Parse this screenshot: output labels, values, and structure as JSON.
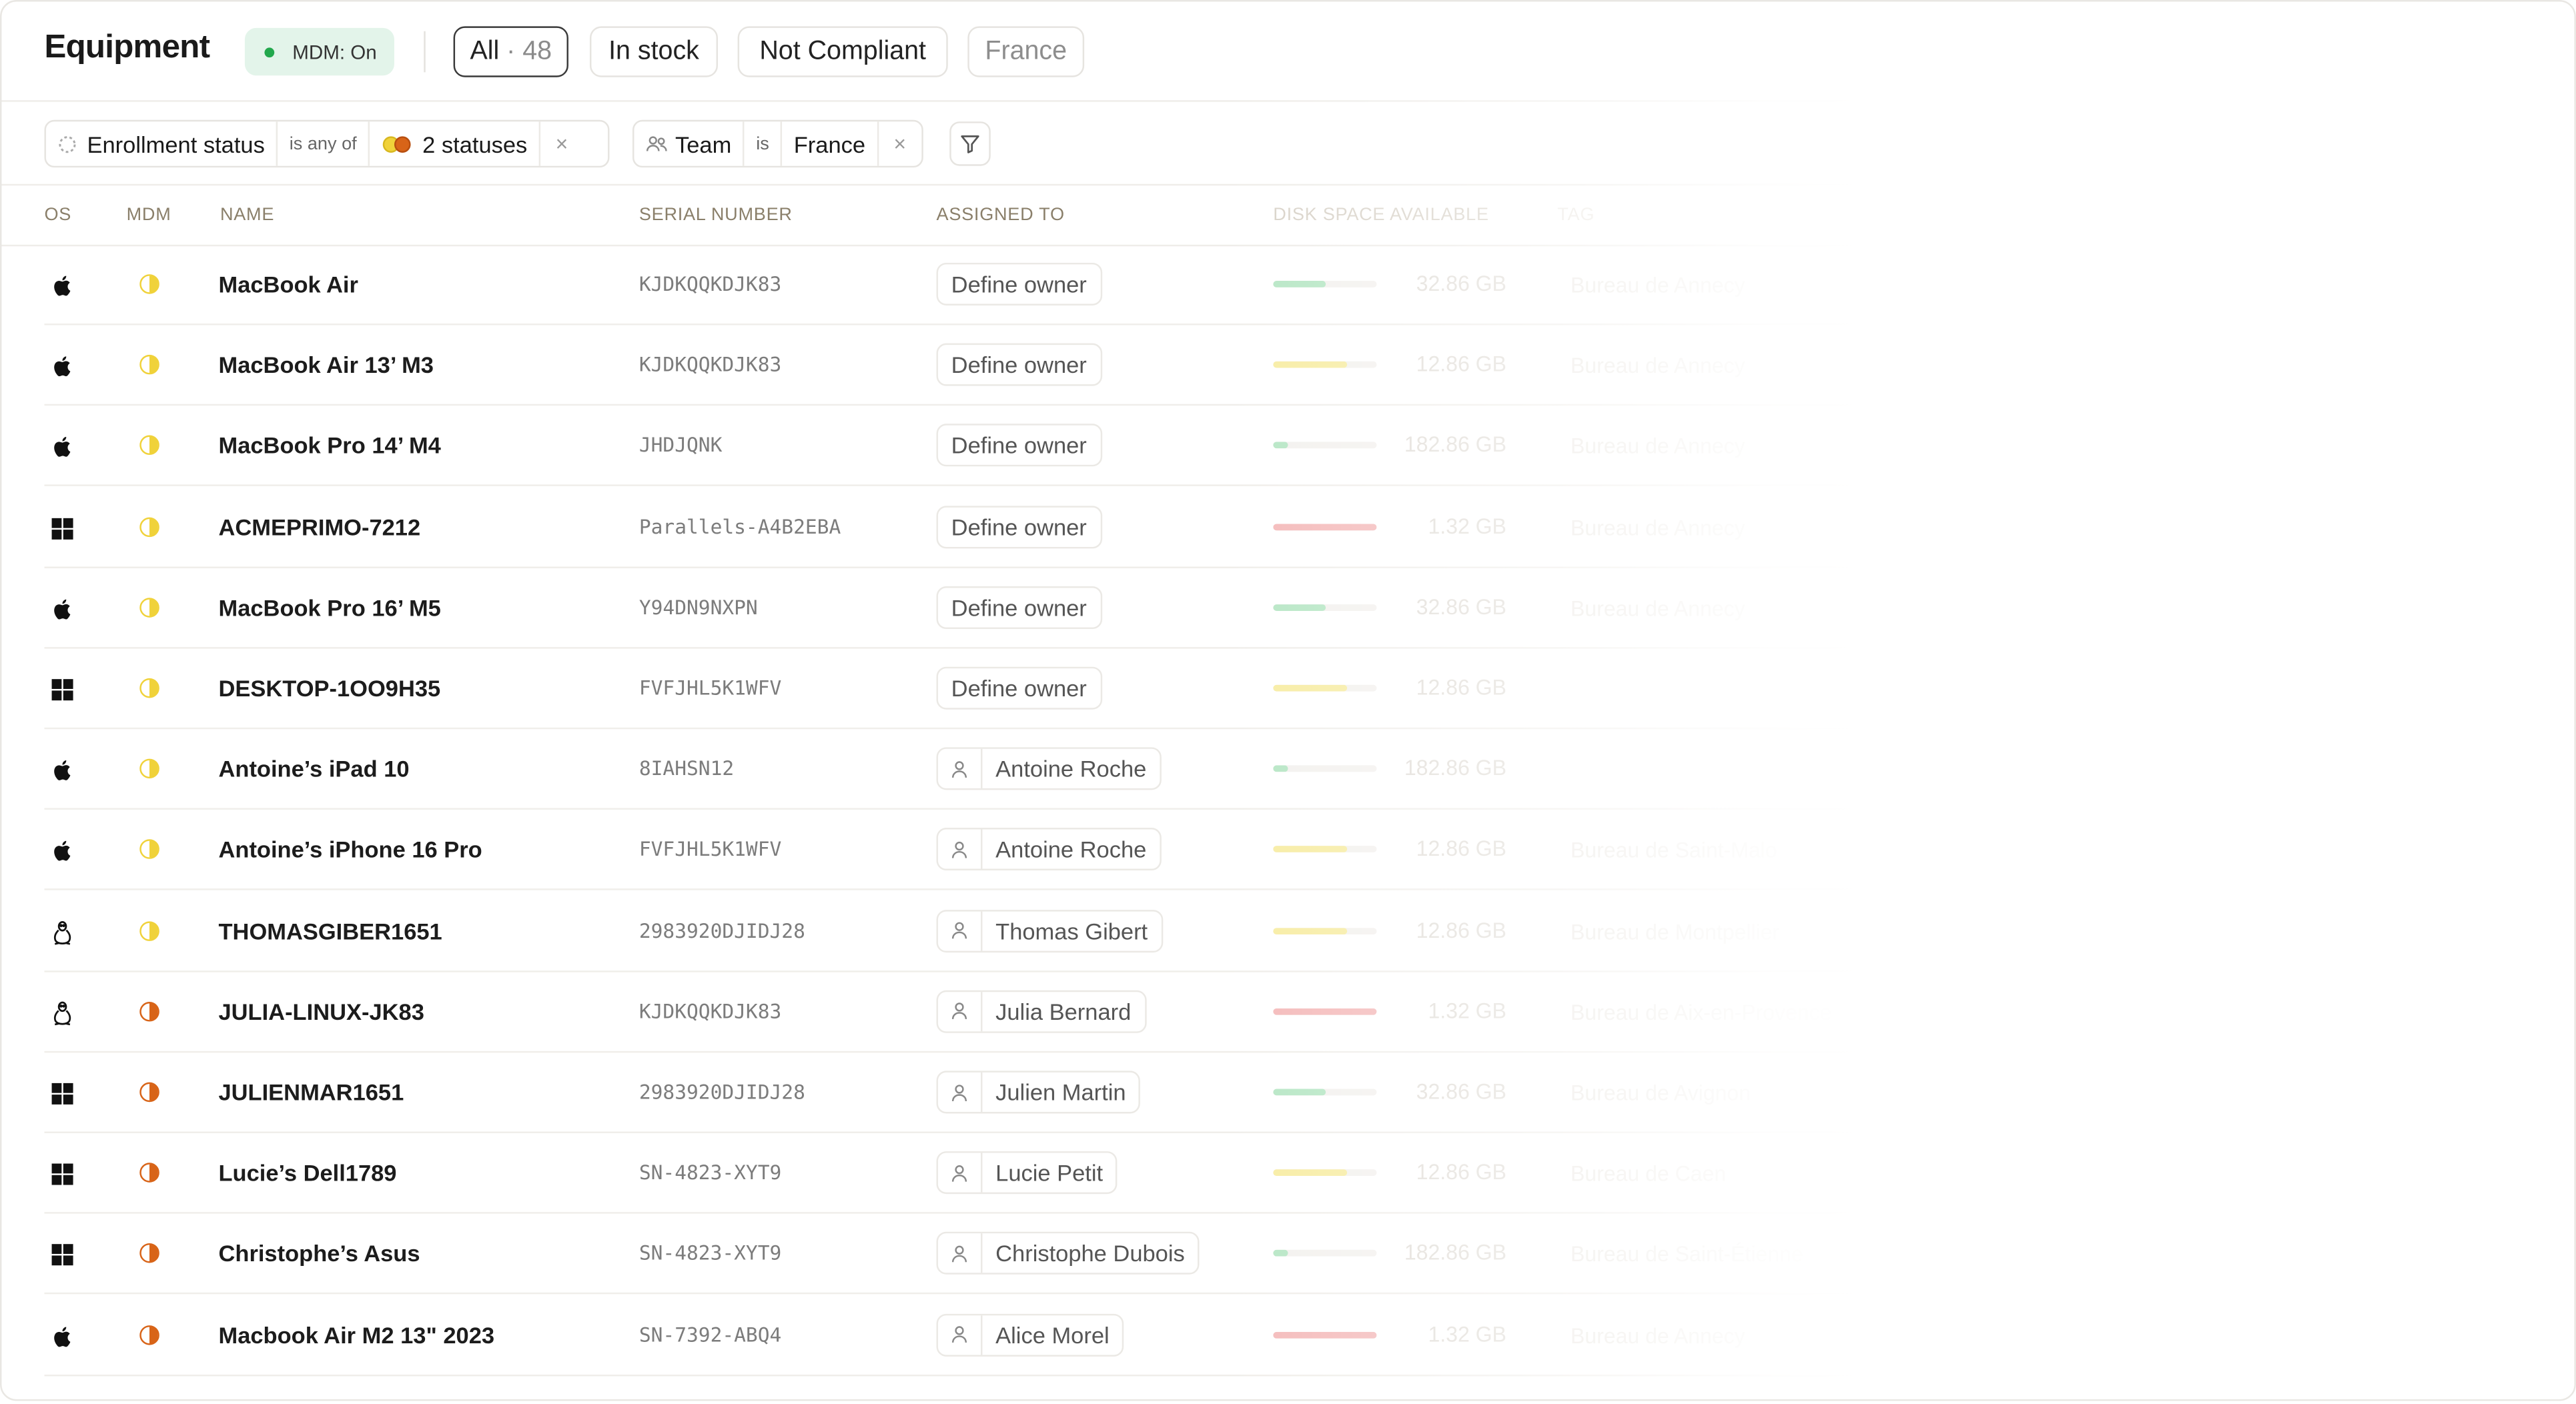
{
  "header": {
    "title": "Equipment",
    "mdm_badge": "MDM: On",
    "tabs": [
      {
        "label": "All",
        "count": "48"
      },
      {
        "label": "In stock"
      },
      {
        "label": "Not Compliant"
      },
      {
        "label": "France"
      }
    ]
  },
  "filters": {
    "enrollment": {
      "field": "Enrollment status",
      "operator": "is any of",
      "value": "2 statuses"
    },
    "team": {
      "field": "Team",
      "operator": "is",
      "value": "France"
    }
  },
  "columns": {
    "os": "OS",
    "mdm": "MDM",
    "name": "NAME",
    "serial": "SERIAL NUMBER",
    "assigned": "ASSIGNED TO",
    "disk": "DISK SPACE AVAILABLE",
    "tag": "TAG"
  },
  "colors": {
    "disk_ok": "#b6e6c4",
    "disk_warn": "#f7eca2",
    "disk_low": "#f4b9b9",
    "mdm_partial": "#f0d23a",
    "mdm_fail": "#d86418",
    "badge_bg": "#e3f4ea",
    "badge_dot": "#22a84d"
  },
  "rows": [
    {
      "os": "apple",
      "mdm": "partial",
      "name": "MacBook Air",
      "serial": "KJDKQQKDJK83",
      "owner": "Define owner",
      "owner_type": "undefined",
      "disk_fraction": 0.5,
      "disk_status": "ok",
      "disk": "32.86 GB",
      "tag": "Bureau de Annecy"
    },
    {
      "os": "apple",
      "mdm": "partial",
      "name": "MacBook Air 13’ M3",
      "serial": "KJDKQQKDJK83",
      "owner": "Define owner",
      "owner_type": "undefined",
      "disk_fraction": 0.72,
      "disk_status": "warn",
      "disk": "12.86 GB",
      "tag": "Bureau de Annecy"
    },
    {
      "os": "apple",
      "mdm": "partial",
      "name": "MacBook Pro 14’ M4",
      "serial": "JHDJQNK",
      "owner": "Define owner",
      "owner_type": "undefined",
      "disk_fraction": 0.15,
      "disk_status": "ok",
      "disk": "182.86 GB",
      "tag": "Bureau de Annecy"
    },
    {
      "os": "windows",
      "mdm": "partial",
      "name": "ACMEPRIMO-7212",
      "serial": "Parallels-A4B2EBA",
      "owner": "Define owner",
      "owner_type": "undefined",
      "disk_fraction": 1.0,
      "disk_status": "low",
      "disk": "1.32 GB",
      "tag": "Bureau de Annecy"
    },
    {
      "os": "apple",
      "mdm": "partial",
      "name": "MacBook Pro 16’ M5",
      "serial": "Y94DN9NXPN",
      "owner": "Define owner",
      "owner_type": "undefined",
      "disk_fraction": 0.5,
      "disk_status": "ok",
      "disk": "32.86 GB",
      "tag": "Bureau de Annecy"
    },
    {
      "os": "windows",
      "mdm": "partial",
      "name": "DESKTOP-1OO9H35",
      "serial": "FVFJHL5K1WFV",
      "owner": "Define owner",
      "owner_type": "undefined",
      "disk_fraction": 0.72,
      "disk_status": "warn",
      "disk": "12.86 GB",
      "tag": ""
    },
    {
      "os": "apple",
      "mdm": "partial",
      "name": "Antoine’s iPad 10",
      "serial": "8IAHSN12",
      "owner": "Antoine Roche",
      "owner_type": "person",
      "disk_fraction": 0.15,
      "disk_status": "ok",
      "disk": "182.86 GB",
      "tag": ""
    },
    {
      "os": "apple",
      "mdm": "partial",
      "name": "Antoine’s iPhone 16 Pro",
      "serial": "FVFJHL5K1WFV",
      "owner": "Antoine Roche",
      "owner_type": "person",
      "disk_fraction": 0.72,
      "disk_status": "warn",
      "disk": "12.86 GB",
      "tag": "Bureau de Saint-Malo"
    },
    {
      "os": "linux",
      "mdm": "partial",
      "name": "THOMASGIBER1651",
      "serial": "2983920DJIDJ28",
      "owner": "Thomas Gibert",
      "owner_type": "person",
      "disk_fraction": 0.72,
      "disk_status": "warn",
      "disk": "12.86 GB",
      "tag": "Bureau de Montpellier"
    },
    {
      "os": "linux",
      "mdm": "fail",
      "name": "JULIA-LINUX-JK83",
      "serial": "KJDKQQKDJK83",
      "owner": "Julia Bernard",
      "owner_type": "person",
      "disk_fraction": 1.0,
      "disk_status": "low",
      "disk": "1.32 GB",
      "tag": "Bureau de Aix-en-Provence"
    },
    {
      "os": "windows",
      "mdm": "fail",
      "name": "JULIENMAR1651",
      "serial": "2983920DJIDJ28",
      "owner": "Julien Martin",
      "owner_type": "person",
      "disk_fraction": 0.5,
      "disk_status": "ok",
      "disk": "32.86 GB",
      "tag": "Bureau de Avignon"
    },
    {
      "os": "windows",
      "mdm": "fail",
      "name": "Lucie’s Dell1789",
      "serial": "SN-4823-XYT9",
      "owner": "Lucie Petit",
      "owner_type": "person",
      "disk_fraction": 0.72,
      "disk_status": "warn",
      "disk": "12.86 GB",
      "tag": "Bureau de Caen"
    },
    {
      "os": "windows",
      "mdm": "fail",
      "name": "Christophe’s Asus",
      "serial": "SN-4823-XYT9",
      "owner": "Christophe Dubois",
      "owner_type": "person",
      "disk_fraction": 0.15,
      "disk_status": "ok",
      "disk": "182.86 GB",
      "tag": "Bureau de Saint-Étienne"
    },
    {
      "os": "apple",
      "mdm": "fail",
      "name": "Macbook Air M2 13\" 2023",
      "serial": "SN-7392-ABQ4",
      "owner": "Alice Morel",
      "owner_type": "person",
      "disk_fraction": 1.0,
      "disk_status": "low",
      "disk": "1.32 GB",
      "tag": "Bureau de Annecy"
    }
  ]
}
